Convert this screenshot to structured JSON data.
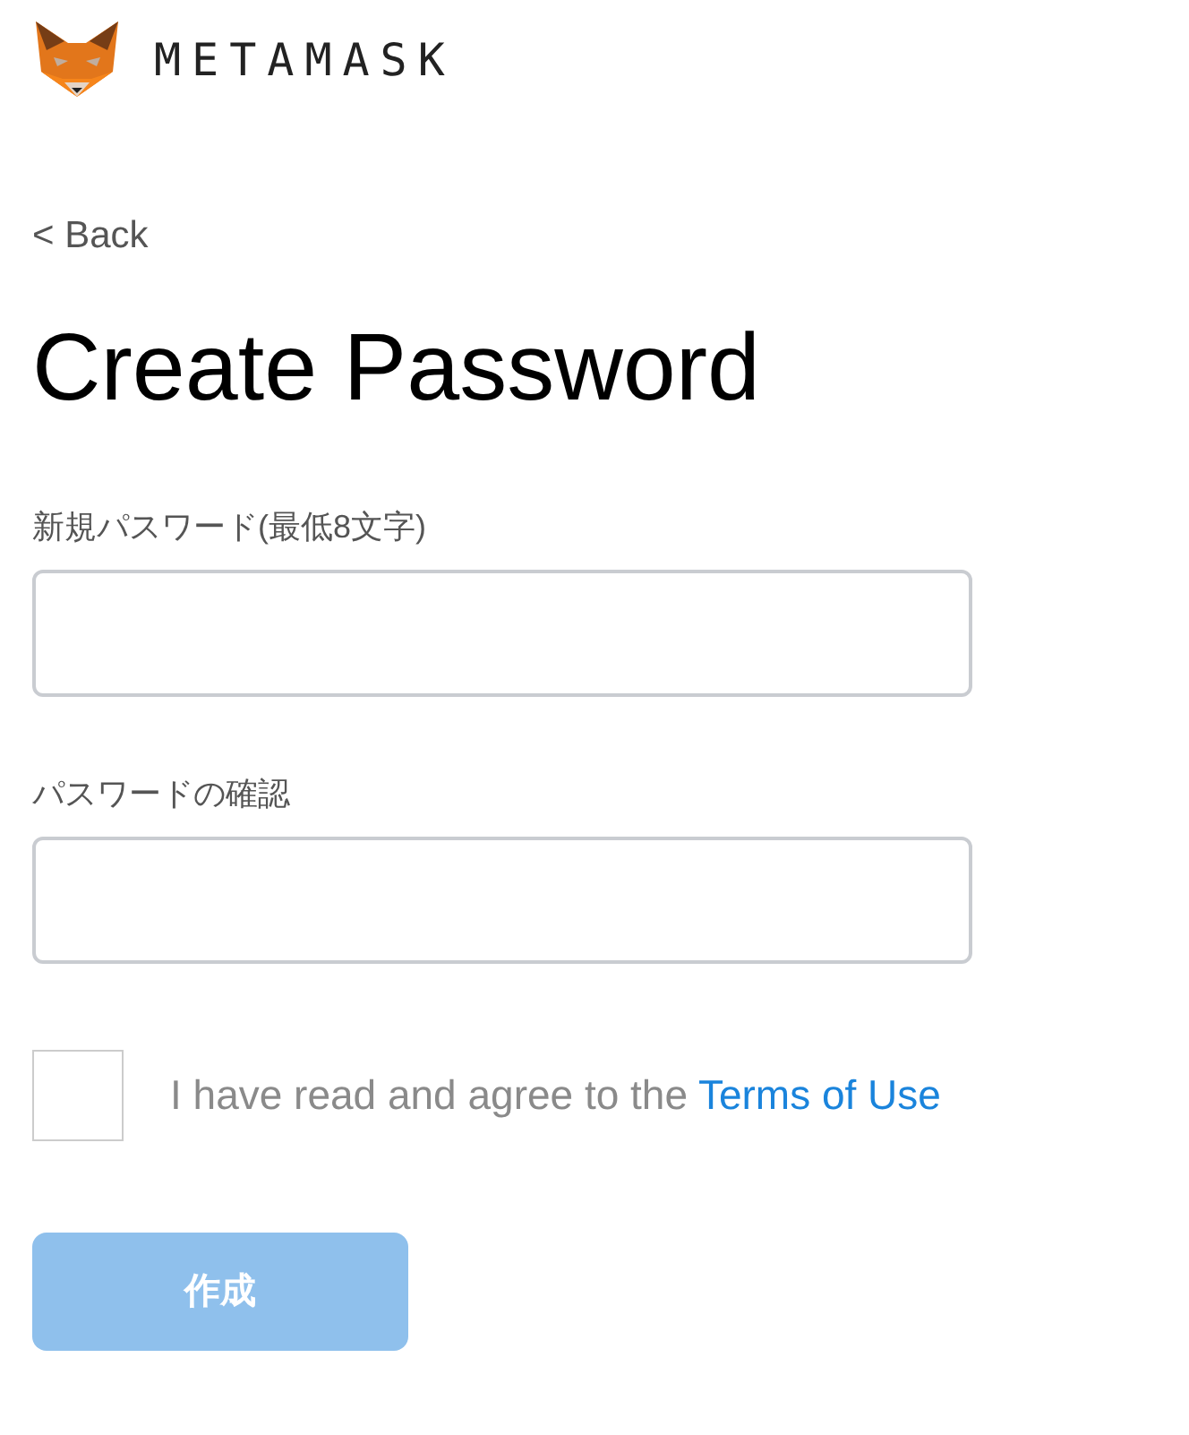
{
  "logo": {
    "wordmark": "METAMASK"
  },
  "back_link": "< Back",
  "title": "Create Password",
  "fields": [
    {
      "label": "新規パスワード(最低8文字)"
    },
    {
      "label": "パスワードの確認"
    }
  ],
  "terms": {
    "checked": false,
    "text": "I have read and agree to the ",
    "link": "Terms of Use"
  },
  "create_button": {
    "label": "作成",
    "disabled": true
  }
}
